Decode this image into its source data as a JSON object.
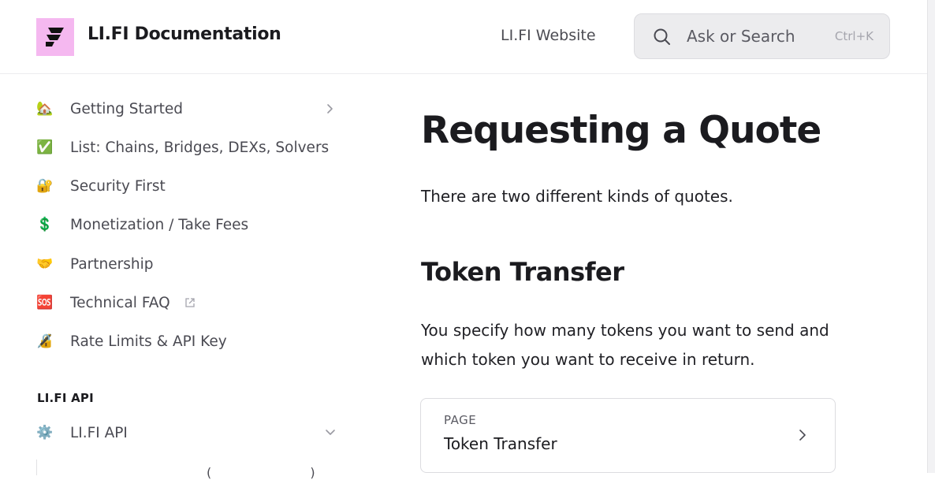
{
  "header": {
    "title": "LI.FI Documentation",
    "website_link": "LI.FI Website",
    "search": {
      "placeholder": "Ask or Search",
      "shortcut": "Ctrl+K"
    }
  },
  "sidebar": {
    "items": [
      {
        "emoji": "🏡",
        "label": "Getting Started"
      },
      {
        "emoji": "✅",
        "label": "List: Chains, Bridges, DEXs, Solvers"
      },
      {
        "emoji": "🔐",
        "label": "Security First"
      },
      {
        "emoji": "💲",
        "label": "Monetization / Take Fees"
      },
      {
        "emoji": "🤝",
        "label": "Partnership"
      },
      {
        "emoji": "🆘",
        "label": "Technical FAQ"
      },
      {
        "emoji": "🔏",
        "label": "Rate Limits & API Key"
      }
    ],
    "section_heading": "LI.FI API",
    "section_items": [
      {
        "emoji": "⚙️",
        "label": "LI.FI API"
      }
    ],
    "cutoff_text": "( )"
  },
  "main": {
    "title": "Requesting a Quote",
    "intro": "There are two different kinds of quotes.",
    "section_title": "Token Transfer",
    "paragraph": "You specify how many tokens you want to send and which token you want to receive in return.",
    "card": {
      "kicker": "PAGE",
      "title": "Token Transfer"
    }
  },
  "colors": {
    "logo_bg": "#f5b8f0",
    "search_bg": "#ececee",
    "text_primary": "#1b1b1f",
    "text_secondary": "#4a4a52"
  }
}
